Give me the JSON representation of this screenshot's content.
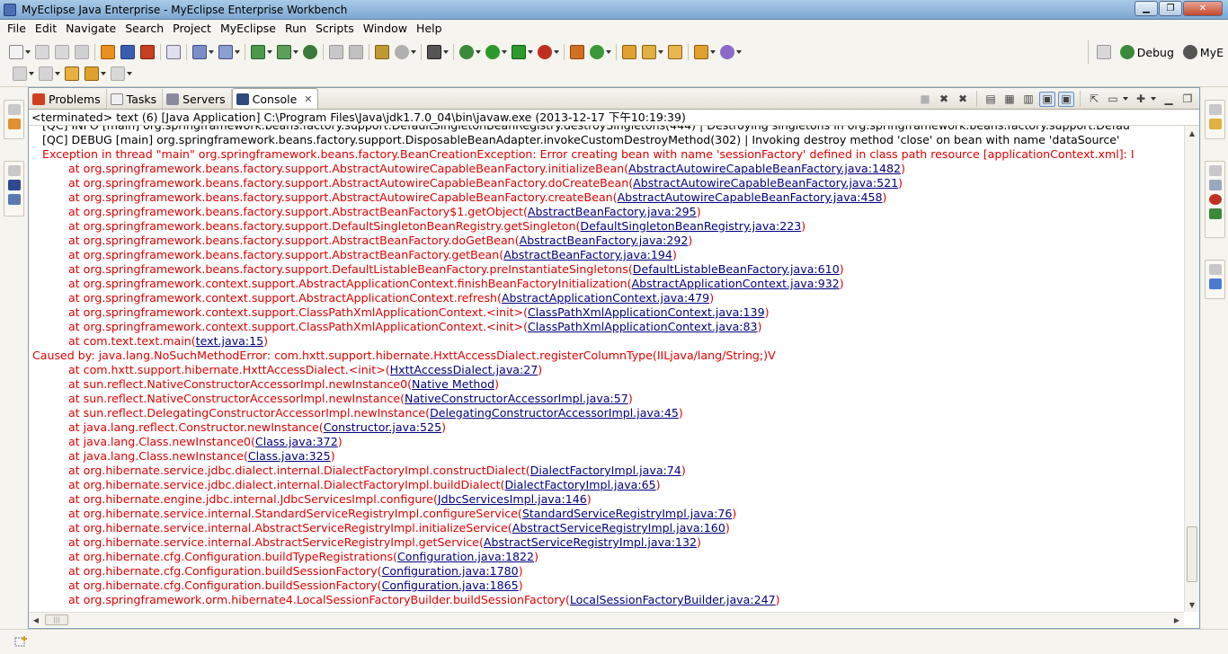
{
  "window": {
    "title": "MyEclipse Java Enterprise - MyEclipse Enterprise Workbench",
    "minimize_glyph": "▁",
    "maximize_glyph": "❐",
    "close_glyph": "✕"
  },
  "menu": [
    "File",
    "Edit",
    "Navigate",
    "Search",
    "Project",
    "MyEclipse",
    "Run",
    "Scripts",
    "Window",
    "Help"
  ],
  "perspectives": {
    "debug_label": "Debug",
    "myeclipse_label": "MyE"
  },
  "colors": {
    "stderr": "#e00000",
    "link": "#000080",
    "stdout": "#000000"
  },
  "tabs": {
    "problems": "Problems",
    "tasks": "Tasks",
    "servers": "Servers",
    "console": "Console",
    "close_glyph": "✕"
  },
  "console": {
    "status": "<terminated> text (6) [Java Application] C:\\Program Files\\Java\\jdk1.7.0_04\\bin\\javaw.exe (2013-12-17 下午10:19:39)",
    "lines": [
      {
        "kind": "info",
        "text": "[QC] INFO [main] org.springframework.beans.factory.support.DefaultSingletonBeanRegistry.destroySingletons(444) | Destroying singletons in org.springframework.beans.factory.support.Defau",
        "link": ""
      },
      {
        "kind": "info",
        "text": "[QC] DEBUG [main] org.springframework.beans.factory.support.DisposableBeanAdapter.invokeCustomDestroyMethod(302) | Invoking destroy method 'close' on bean with name 'dataSource'",
        "link": ""
      },
      {
        "kind": "err",
        "text": "Exception in thread \"main\" org.springframework.beans.factory.BeanCreationException: Error creating bean with name 'sessionFactory' defined in class path resource [applicationContext.xml]: I",
        "link": ""
      },
      {
        "kind": "at",
        "text": "at org.springframework.beans.factory.support.AbstractAutowireCapableBeanFactory.initializeBean(",
        "link": "AbstractAutowireCapableBeanFactory.java:1482"
      },
      {
        "kind": "at",
        "text": "at org.springframework.beans.factory.support.AbstractAutowireCapableBeanFactory.doCreateBean(",
        "link": "AbstractAutowireCapableBeanFactory.java:521"
      },
      {
        "kind": "at",
        "text": "at org.springframework.beans.factory.support.AbstractAutowireCapableBeanFactory.createBean(",
        "link": "AbstractAutowireCapableBeanFactory.java:458"
      },
      {
        "kind": "at",
        "text": "at org.springframework.beans.factory.support.AbstractBeanFactory$1.getObject(",
        "link": "AbstractBeanFactory.java:295"
      },
      {
        "kind": "at",
        "text": "at org.springframework.beans.factory.support.DefaultSingletonBeanRegistry.getSingleton(",
        "link": "DefaultSingletonBeanRegistry.java:223"
      },
      {
        "kind": "at",
        "text": "at org.springframework.beans.factory.support.AbstractBeanFactory.doGetBean(",
        "link": "AbstractBeanFactory.java:292"
      },
      {
        "kind": "at",
        "text": "at org.springframework.beans.factory.support.AbstractBeanFactory.getBean(",
        "link": "AbstractBeanFactory.java:194"
      },
      {
        "kind": "at",
        "text": "at org.springframework.beans.factory.support.DefaultListableBeanFactory.preInstantiateSingletons(",
        "link": "DefaultListableBeanFactory.java:610"
      },
      {
        "kind": "at",
        "text": "at org.springframework.context.support.AbstractApplicationContext.finishBeanFactoryInitialization(",
        "link": "AbstractApplicationContext.java:932"
      },
      {
        "kind": "at",
        "text": "at org.springframework.context.support.AbstractApplicationContext.refresh(",
        "link": "AbstractApplicationContext.java:479"
      },
      {
        "kind": "at",
        "text": "at org.springframework.context.support.ClassPathXmlApplicationContext.<init>(",
        "link": "ClassPathXmlApplicationContext.java:139"
      },
      {
        "kind": "at",
        "text": "at org.springframework.context.support.ClassPathXmlApplicationContext.<init>(",
        "link": "ClassPathXmlApplicationContext.java:83"
      },
      {
        "kind": "at",
        "text": "at com.text.text.main(",
        "link": "text.java:15"
      },
      {
        "kind": "cause",
        "text": "Caused by: java.lang.NoSuchMethodError: com.hxtt.support.hibernate.HxttAccessDialect.registerColumnType(IILjava/lang/String;)V",
        "link": ""
      },
      {
        "kind": "at",
        "text": "at com.hxtt.support.hibernate.HxttAccessDialect.<init>(",
        "link": "HxttAccessDialect.java:27"
      },
      {
        "kind": "at",
        "text": "at sun.reflect.NativeConstructorAccessorImpl.newInstance0(",
        "link": "Native Method"
      },
      {
        "kind": "at",
        "text": "at sun.reflect.NativeConstructorAccessorImpl.newInstance(",
        "link": "NativeConstructorAccessorImpl.java:57"
      },
      {
        "kind": "at",
        "text": "at sun.reflect.DelegatingConstructorAccessorImpl.newInstance(",
        "link": "DelegatingConstructorAccessorImpl.java:45"
      },
      {
        "kind": "at",
        "text": "at java.lang.reflect.Constructor.newInstance(",
        "link": "Constructor.java:525"
      },
      {
        "kind": "at",
        "text": "at java.lang.Class.newInstance0(",
        "link": "Class.java:372"
      },
      {
        "kind": "at",
        "text": "at java.lang.Class.newInstance(",
        "link": "Class.java:325"
      },
      {
        "kind": "at",
        "text": "at org.hibernate.service.jdbc.dialect.internal.DialectFactoryImpl.constructDialect(",
        "link": "DialectFactoryImpl.java:74"
      },
      {
        "kind": "at",
        "text": "at org.hibernate.service.jdbc.dialect.internal.DialectFactoryImpl.buildDialect(",
        "link": "DialectFactoryImpl.java:65"
      },
      {
        "kind": "at",
        "text": "at org.hibernate.engine.jdbc.internal.JdbcServicesImpl.configure(",
        "link": "JdbcServicesImpl.java:146"
      },
      {
        "kind": "at",
        "text": "at org.hibernate.service.internal.StandardServiceRegistryImpl.configureService(",
        "link": "StandardServiceRegistryImpl.java:76"
      },
      {
        "kind": "at",
        "text": "at org.hibernate.service.internal.AbstractServiceRegistryImpl.initializeService(",
        "link": "AbstractServiceRegistryImpl.java:160"
      },
      {
        "kind": "at",
        "text": "at org.hibernate.service.internal.AbstractServiceRegistryImpl.getService(",
        "link": "AbstractServiceRegistryImpl.java:132"
      },
      {
        "kind": "at",
        "text": "at org.hibernate.cfg.Configuration.buildTypeRegistrations(",
        "link": "Configuration.java:1822"
      },
      {
        "kind": "at",
        "text": "at org.hibernate.cfg.Configuration.buildSessionFactory(",
        "link": "Configuration.java:1780"
      },
      {
        "kind": "at",
        "text": "at org.hibernate.cfg.Configuration.buildSessionFactory(",
        "link": "Configuration.java:1865"
      },
      {
        "kind": "at",
        "text": "at org.springframework.orm.hibernate4.LocalSessionFactoryBuilder.buildSessionFactory(",
        "link": "LocalSessionFactoryBuilder.java:247"
      }
    ]
  }
}
